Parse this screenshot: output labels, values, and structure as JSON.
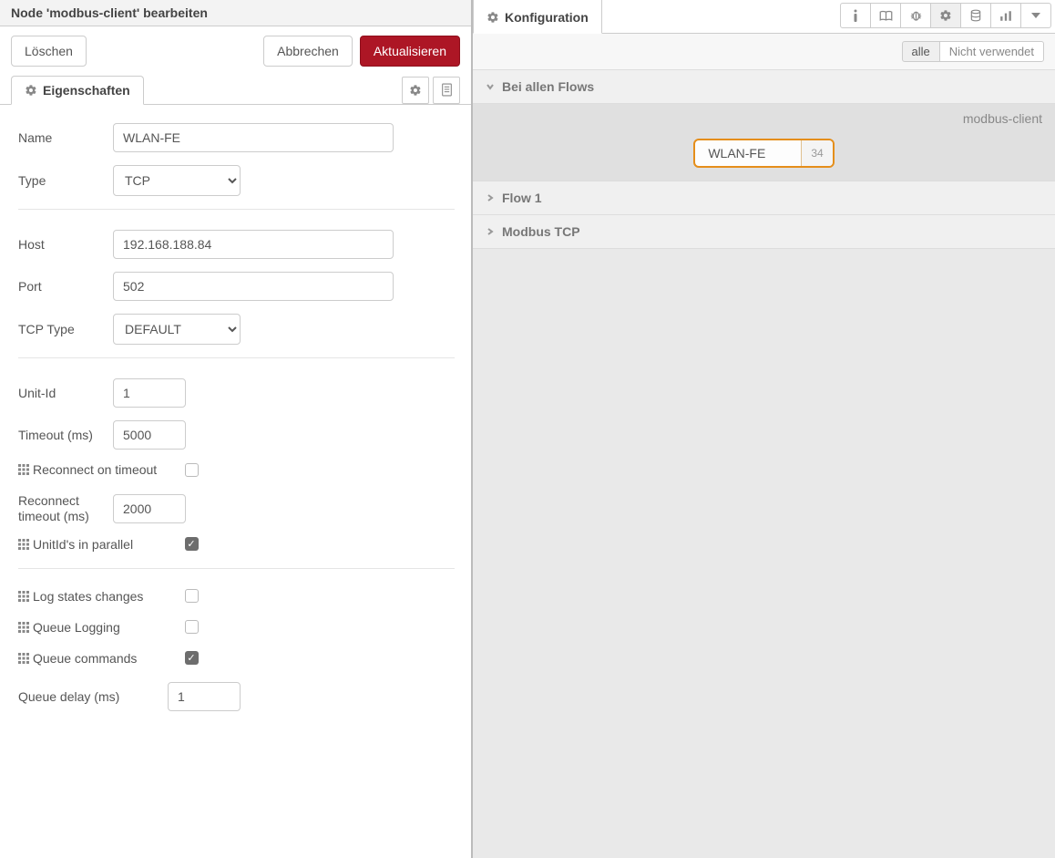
{
  "editor": {
    "title": "Node 'modbus-client' bearbeiten",
    "delete_label": "Löschen",
    "cancel_label": "Abbrechen",
    "update_label": "Aktualisieren",
    "properties_tab": "Eigenschaften",
    "fields": {
      "name_label": "Name",
      "name_value": "WLAN-FE",
      "type_label": "Type",
      "type_value": "TCP",
      "host_label": "Host",
      "host_value": "192.168.188.84",
      "port_label": "Port",
      "port_value": "502",
      "tcptype_label": "TCP Type",
      "tcptype_value": "DEFAULT",
      "unitid_label": "Unit-Id",
      "unitid_value": "1",
      "timeout_label": "Timeout (ms)",
      "timeout_value": "5000",
      "reconnect_label": "Reconnect on timeout",
      "reconnect_checked": false,
      "recon_timeout_label": "Reconnect timeout (ms)",
      "recon_timeout_value": "2000",
      "parallel_label": "UnitId's in parallel",
      "parallel_checked": true,
      "log_states_label": "Log states changes",
      "log_states_checked": false,
      "queue_logging_label": "Queue Logging",
      "queue_logging_checked": false,
      "queue_commands_label": "Queue commands",
      "queue_commands_checked": true,
      "queue_delay_label": "Queue delay (ms)",
      "queue_delay_value": "1"
    }
  },
  "sidebar": {
    "tab_label": "Konfiguration",
    "filter_all": "alle",
    "filter_unused": "Nicht verwendet",
    "sections": {
      "all_flows": "Bei allen Flows",
      "flow1": "Flow 1",
      "modbus": "Modbus TCP"
    },
    "config_type_label": "modbus-client",
    "node": {
      "label": "WLAN-FE",
      "count": "34"
    }
  }
}
